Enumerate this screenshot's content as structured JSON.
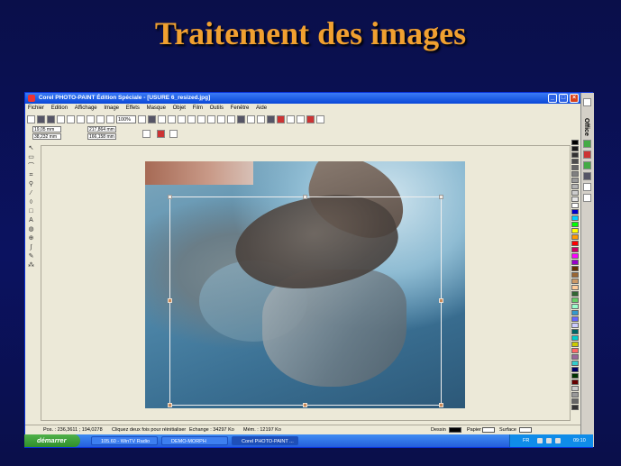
{
  "slide": {
    "title": "Traitement des images"
  },
  "window": {
    "title": "Corel PHOTO-PAINT Édition Spéciale - [USURE 6_resized.jpg]",
    "menu": [
      "Fichier",
      "Edition",
      "Affichage",
      "Image",
      "Effets",
      "Masque",
      "Objet",
      "Film",
      "Outils",
      "Fenêtre",
      "Aide"
    ],
    "zoom": "100%",
    "fields": {
      "x": "19,05 mm",
      "y": "38,232 mm",
      "w": "217,864 mm",
      "h": "166,158 mm"
    }
  },
  "status": {
    "position": "Pos. : 236,3611 ; 194,0278",
    "hint": "Cliquez deux fois pour réinitialiser",
    "exchange": "Echange : 34297 Ko",
    "memory": "Mém. : 12197 Ko",
    "dessin_label": "Dessin",
    "papier_label": "Papier",
    "surface_label": "Surface"
  },
  "office_bar": {
    "label": "Office"
  },
  "taskbar": {
    "start": "démarrer",
    "tasks": [
      "105.60 - WinTV Radio",
      "DEMO-MORPH",
      "Corel PHOTO-PAINT ..."
    ],
    "lang": "FR",
    "clock": "09:10"
  },
  "palette_colors": [
    "#000000",
    "#1a1a1a",
    "#333333",
    "#4d4d4d",
    "#666666",
    "#808080",
    "#999999",
    "#b3b3b3",
    "#cccccc",
    "#e6e6e6",
    "#ffffff",
    "#0000cc",
    "#00ccff",
    "#00ff00",
    "#ffff00",
    "#ff9900",
    "#ff0000",
    "#cc0066",
    "#ff00ff",
    "#9900cc",
    "#663300",
    "#996633",
    "#cc9966",
    "#ffcc99",
    "#336633",
    "#66cc66",
    "#99ffcc",
    "#3399cc",
    "#6666ff",
    "#ccccff",
    "#006666",
    "#00cccc",
    "#cccc00",
    "#ff6666",
    "#996699",
    "#33cccc",
    "#000066",
    "#003300",
    "#660000",
    "#cccccc",
    "#999999",
    "#666666",
    "#333333"
  ]
}
